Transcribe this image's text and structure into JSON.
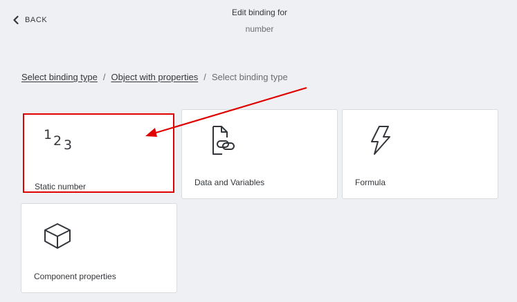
{
  "header": {
    "back_label": "BACK",
    "title": "Edit binding for",
    "subtitle": "number"
  },
  "breadcrumb": {
    "items": [
      "Select binding type",
      "Object with properties"
    ],
    "separator": "/",
    "current": "Select binding type"
  },
  "cards": [
    {
      "label": "Static number",
      "icon": "static-number-icon",
      "glyph": [
        "1",
        "2",
        "3"
      ],
      "selected": true
    },
    {
      "label": "Data and Variables",
      "icon": "data-link-icon",
      "selected": false
    },
    {
      "label": "Formula",
      "icon": "lightning-icon",
      "selected": false
    },
    {
      "label": "Component properties",
      "icon": "cube-icon",
      "selected": false
    }
  ],
  "colors": {
    "background": "#eef0f3",
    "card": "#ffffff",
    "highlight": "#e00000",
    "text": "#32363a",
    "muted": "#6a6d70"
  }
}
